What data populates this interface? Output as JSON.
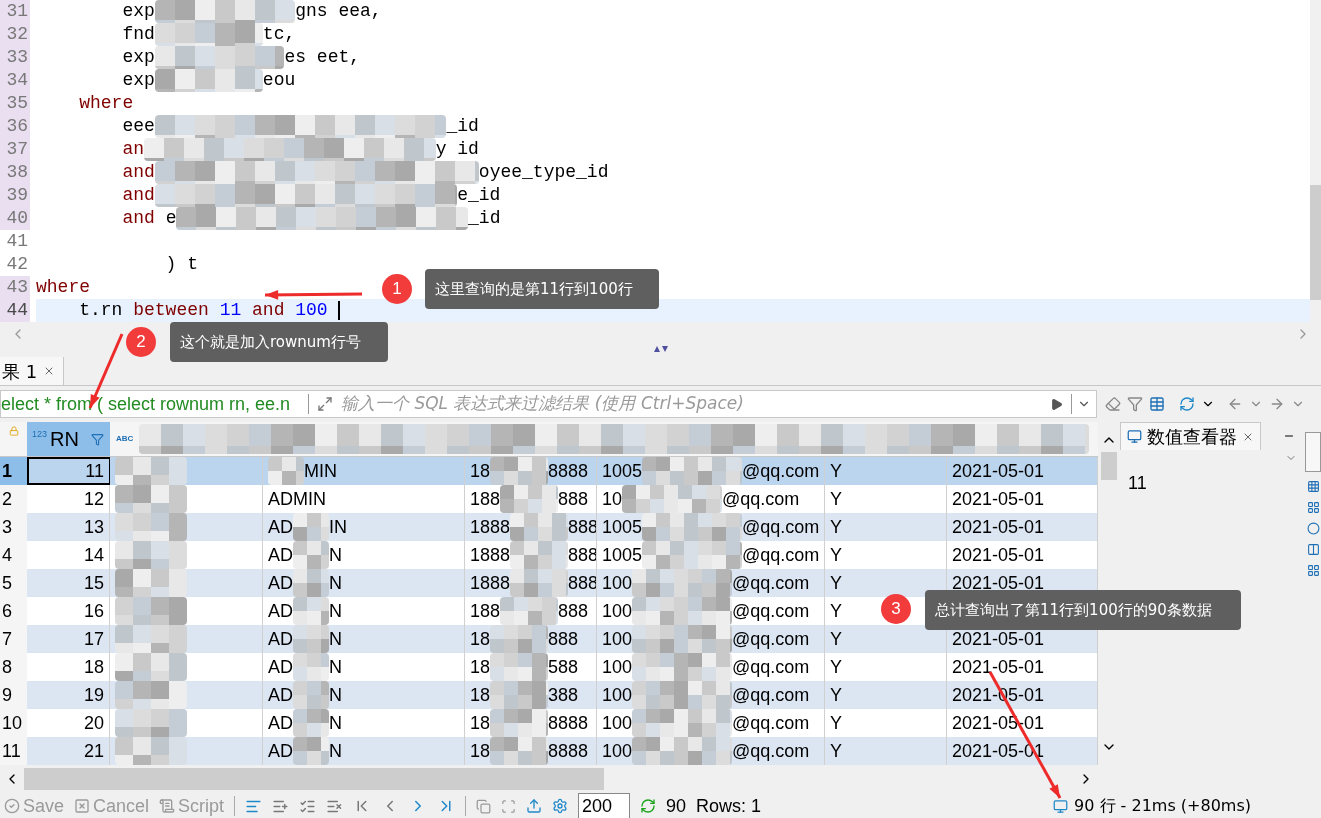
{
  "editor": {
    "lines": [
      {
        "no": "31",
        "marked": true,
        "current": false,
        "parts": [
          {
            "kind": "plain",
            "text": "        exp"
          },
          {
            "kind": "redacted"
          },
          {
            "kind": "plain",
            "text": "gns eea,"
          }
        ]
      },
      {
        "no": "32",
        "marked": true,
        "current": false,
        "parts": [
          {
            "kind": "plain",
            "text": "        fnd"
          },
          {
            "kind": "redacted"
          },
          {
            "kind": "plain",
            "text": "tc,"
          }
        ]
      },
      {
        "no": "33",
        "marked": true,
        "current": false,
        "parts": [
          {
            "kind": "plain",
            "text": "        exp"
          },
          {
            "kind": "redacted"
          },
          {
            "kind": "plain",
            "text": "es eet,"
          }
        ]
      },
      {
        "no": "34",
        "marked": true,
        "current": false,
        "parts": [
          {
            "kind": "plain",
            "text": "        exp"
          },
          {
            "kind": "redacted"
          },
          {
            "kind": "plain",
            "text": "eou"
          }
        ]
      },
      {
        "no": "35",
        "marked": true,
        "current": false,
        "parts": [
          {
            "kind": "keyword",
            "text": "    where"
          }
        ]
      },
      {
        "no": "36",
        "marked": true,
        "current": false,
        "parts": [
          {
            "kind": "plain",
            "text": "        eee"
          },
          {
            "kind": "redacted"
          },
          {
            "kind": "plain",
            "text": "_id"
          }
        ]
      },
      {
        "no": "37",
        "marked": true,
        "current": false,
        "parts": [
          {
            "kind": "keyword",
            "text": "        an"
          },
          {
            "kind": "redacted"
          },
          {
            "kind": "plain",
            "text": "y id"
          }
        ]
      },
      {
        "no": "38",
        "marked": true,
        "current": false,
        "parts": [
          {
            "kind": "keyword",
            "text": "        and"
          },
          {
            "kind": "redacted"
          },
          {
            "kind": "plain",
            "text": "oyee_type_id"
          }
        ]
      },
      {
        "no": "39",
        "marked": true,
        "current": false,
        "parts": [
          {
            "kind": "keyword",
            "text": "        and"
          },
          {
            "kind": "redacted"
          },
          {
            "kind": "plain",
            "text": "e_id"
          }
        ]
      },
      {
        "no": "40",
        "marked": true,
        "current": false,
        "parts": [
          {
            "kind": "keyword",
            "text": "        and"
          },
          {
            "kind": "plain",
            "text": " e"
          },
          {
            "kind": "redacted"
          },
          {
            "kind": "plain",
            "text": "_id"
          }
        ]
      },
      {
        "no": "41",
        "marked": false,
        "current": false
      },
      {
        "no": "42",
        "marked": false,
        "current": false,
        "parts": [
          {
            "kind": "plain",
            "text": "            ) t"
          }
        ]
      },
      {
        "no": "43",
        "marked": true,
        "current": false,
        "parts": [
          {
            "kind": "keyword",
            "text": "where"
          }
        ]
      },
      {
        "no": "44",
        "marked": true,
        "current": true,
        "parts": [
          {
            "kind": "plain",
            "text": "    t.rn "
          },
          {
            "kind": "keyword",
            "text": "between"
          },
          {
            "kind": "number",
            "text": " 11"
          },
          {
            "kind": "keyword",
            "text": " and"
          },
          {
            "kind": "number",
            "text": " 100 "
          }
        ]
      }
    ]
  },
  "result_tabs": [
    {
      "label": "果 1",
      "selected": true
    }
  ],
  "filter": {
    "query": "elect * from ( select rownum rn, ee.n",
    "placeholder": "输入一个 SQL 表达式来过滤结果 (使用 Ctrl+Space)"
  },
  "table": {
    "columns": [
      {
        "label": "RN",
        "type_badge": "123"
      },
      {
        "type_badge": "ABC"
      }
    ],
    "rows": [
      {
        "index": "1",
        "selected": true,
        "rn": "11",
        "col_3": [
          {
            "kind": "redacted"
          },
          {
            "kind": "text",
            "text": "MIN"
          }
        ],
        "col_4": [
          {
            "kind": "text",
            "text": "18"
          },
          {
            "kind": "redacted"
          },
          {
            "kind": "text",
            "text": "8888"
          }
        ],
        "col_5": [
          {
            "kind": "text",
            "text": "1005"
          },
          {
            "kind": "redacted"
          },
          {
            "kind": "text",
            "text": "@qq.com"
          }
        ],
        "col_6": "Y",
        "col_7": "2021-05-01"
      },
      {
        "index": "2",
        "selected": false,
        "rn": "12",
        "col_3": [
          {
            "kind": "text",
            "text": "ADMIN"
          }
        ],
        "col_4": [
          {
            "kind": "text",
            "text": "188"
          },
          {
            "kind": "redacted"
          },
          {
            "kind": "text",
            "text": "888"
          }
        ],
        "col_5": [
          {
            "kind": "text",
            "text": "10"
          },
          {
            "kind": "redacted"
          },
          {
            "kind": "text",
            "text": "@qq.com"
          }
        ],
        "col_6": "Y",
        "col_7": "2021-05-01"
      },
      {
        "index": "3",
        "selected": false,
        "rn": "13",
        "col_3": [
          {
            "kind": "text",
            "text": "AD"
          },
          {
            "kind": "redacted"
          },
          {
            "kind": "text",
            "text": "IN"
          }
        ],
        "col_4": [
          {
            "kind": "text",
            "text": "1888"
          },
          {
            "kind": "redacted"
          },
          {
            "kind": "text",
            "text": "888"
          }
        ],
        "col_5": [
          {
            "kind": "text",
            "text": "1005"
          },
          {
            "kind": "redacted"
          },
          {
            "kind": "text",
            "text": "@qq.com"
          }
        ],
        "col_6": "Y",
        "col_7": "2021-05-01"
      },
      {
        "index": "4",
        "selected": false,
        "rn": "14",
        "col_3": [
          {
            "kind": "text",
            "text": "AD"
          },
          {
            "kind": "redacted"
          },
          {
            "kind": "text",
            "text": "N"
          }
        ],
        "col_4": [
          {
            "kind": "text",
            "text": "1888"
          },
          {
            "kind": "redacted"
          },
          {
            "kind": "text",
            "text": "888"
          }
        ],
        "col_5": [
          {
            "kind": "text",
            "text": "1005"
          },
          {
            "kind": "redacted"
          },
          {
            "kind": "text",
            "text": "@qq.com"
          }
        ],
        "col_6": "Y",
        "col_7": "2021-05-01"
      },
      {
        "index": "5",
        "selected": false,
        "rn": "15",
        "col_3": [
          {
            "kind": "text",
            "text": "AD"
          },
          {
            "kind": "redacted"
          },
          {
            "kind": "text",
            "text": "N"
          }
        ],
        "col_4": [
          {
            "kind": "text",
            "text": "1888"
          },
          {
            "kind": "redacted"
          },
          {
            "kind": "text",
            "text": "888"
          }
        ],
        "col_5": [
          {
            "kind": "text",
            "text": "100"
          },
          {
            "kind": "redacted"
          },
          {
            "kind": "text",
            "text": "@qq.com"
          }
        ],
        "col_6": "Y",
        "col_7": "2021-05-01"
      },
      {
        "index": "6",
        "selected": false,
        "rn": "16",
        "col_3": [
          {
            "kind": "text",
            "text": "AD"
          },
          {
            "kind": "redacted"
          },
          {
            "kind": "text",
            "text": "N"
          }
        ],
        "col_4": [
          {
            "kind": "text",
            "text": "188"
          },
          {
            "kind": "redacted"
          },
          {
            "kind": "text",
            "text": "888"
          }
        ],
        "col_5": [
          {
            "kind": "text",
            "text": "100"
          },
          {
            "kind": "redacted"
          },
          {
            "kind": "text",
            "text": "@qq.com"
          }
        ],
        "col_6": "Y"
      },
      {
        "index": "7",
        "selected": false,
        "rn": "17",
        "col_3": [
          {
            "kind": "text",
            "text": "AD"
          },
          {
            "kind": "redacted"
          },
          {
            "kind": "text",
            "text": "N"
          }
        ],
        "col_4": [
          {
            "kind": "text",
            "text": "18"
          },
          {
            "kind": "redacted"
          },
          {
            "kind": "text",
            "text": "888"
          }
        ],
        "col_5": [
          {
            "kind": "text",
            "text": "100"
          },
          {
            "kind": "redacted"
          },
          {
            "kind": "text",
            "text": "@qq.com"
          }
        ],
        "col_6": "Y",
        "col_7": "2021-05-01"
      },
      {
        "index": "8",
        "selected": false,
        "rn": "18",
        "col_3": [
          {
            "kind": "text",
            "text": "AD"
          },
          {
            "kind": "redacted"
          },
          {
            "kind": "text",
            "text": "N"
          }
        ],
        "col_4": [
          {
            "kind": "text",
            "text": "18"
          },
          {
            "kind": "redacted"
          },
          {
            "kind": "text",
            "text": "588"
          }
        ],
        "col_5": [
          {
            "kind": "text",
            "text": "100"
          },
          {
            "kind": "redacted"
          },
          {
            "kind": "text",
            "text": "@qq.com"
          }
        ],
        "col_6": "Y",
        "col_7": "2021-05-01"
      },
      {
        "index": "9",
        "selected": false,
        "rn": "19",
        "col_3": [
          {
            "kind": "text",
            "text": "AD"
          },
          {
            "kind": "redacted"
          },
          {
            "kind": "text",
            "text": "N"
          }
        ],
        "col_4": [
          {
            "kind": "text",
            "text": "18"
          },
          {
            "kind": "redacted"
          },
          {
            "kind": "text",
            "text": "388"
          }
        ],
        "col_5": [
          {
            "kind": "text",
            "text": "100"
          },
          {
            "kind": "redacted"
          },
          {
            "kind": "text",
            "text": "@qq.com"
          }
        ],
        "col_6": "Y",
        "col_7": "2021-05-01"
      },
      {
        "index": "10",
        "selected": false,
        "rn": "20",
        "col_3": [
          {
            "kind": "text",
            "text": "AD"
          },
          {
            "kind": "redacted"
          },
          {
            "kind": "text",
            "text": "N"
          }
        ],
        "col_4": [
          {
            "kind": "text",
            "text": "18"
          },
          {
            "kind": "redacted"
          },
          {
            "kind": "text",
            "text": "8888"
          }
        ],
        "col_5": [
          {
            "kind": "text",
            "text": "100"
          },
          {
            "kind": "redacted"
          },
          {
            "kind": "text",
            "text": "@qq.com"
          }
        ],
        "col_6": "Y",
        "col_7": "2021-05-01"
      },
      {
        "index": "11",
        "selected": false,
        "rn": "21",
        "col_3": [
          {
            "kind": "text",
            "text": "AD"
          },
          {
            "kind": "redacted"
          },
          {
            "kind": "text",
            "text": "N"
          }
        ],
        "col_4": [
          {
            "kind": "text",
            "text": "18"
          },
          {
            "kind": "redacted"
          },
          {
            "kind": "text",
            "text": "8888"
          }
        ],
        "col_5": [
          {
            "kind": "text",
            "text": "100"
          },
          {
            "kind": "redacted"
          },
          {
            "kind": "text",
            "text": "@qq.com"
          }
        ],
        "col_6": "Y",
        "col_7": "2021-05-01"
      }
    ]
  },
  "value_viewer": {
    "title": "数值查看器",
    "value": "11"
  },
  "bottom_bar": {
    "actions": [
      {
        "kind": "save",
        "label": "Save",
        "disabled": true
      },
      {
        "kind": "cancel",
        "label": "Cancel",
        "disabled": true
      },
      {
        "kind": "script",
        "label": "Script",
        "disabled": true
      }
    ],
    "nav": [
      {
        "kind": "first",
        "disabled": true
      },
      {
        "kind": "prev",
        "disabled": true
      },
      {
        "kind": "next",
        "disabled": false
      },
      {
        "kind": "last",
        "disabled": false
      }
    ],
    "fetch_size": "200",
    "fetched": "90",
    "rows": "Rows: 1",
    "summary": "90 行 - 21ms (+80ms)"
  },
  "annotations": [
    {
      "number": "1",
      "text": "这里查询的是第11行到100行"
    },
    {
      "number": "2",
      "text": "这个就是加入rownum行号"
    },
    {
      "number": "3",
      "text": "总计查询出了第11行到100行的90条数据"
    }
  ]
}
